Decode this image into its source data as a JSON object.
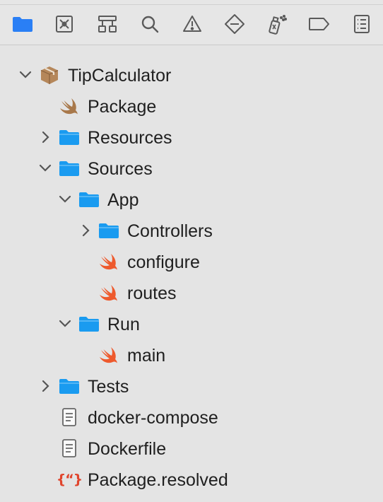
{
  "toolbar": {
    "items": [
      {
        "name": "project-navigator",
        "icon": "folder-icon",
        "active": true
      },
      {
        "name": "source-control-navigator",
        "icon": "source-control-icon"
      },
      {
        "name": "symbol-navigator",
        "icon": "hierarchy-icon"
      },
      {
        "name": "find-navigator",
        "icon": "search-icon"
      },
      {
        "name": "issue-navigator",
        "icon": "warning-icon"
      },
      {
        "name": "test-navigator",
        "icon": "test-diamond-icon"
      },
      {
        "name": "debug-navigator",
        "icon": "spray-icon"
      },
      {
        "name": "breakpoint-navigator",
        "icon": "breakpoint-icon"
      },
      {
        "name": "report-navigator",
        "icon": "report-icon"
      }
    ]
  },
  "tree": [
    {
      "label": "TipCalculator",
      "icon": "package-box-icon",
      "expanded": true
    },
    {
      "label": "Package",
      "icon": "swift-brown-icon"
    },
    {
      "label": "Resources",
      "icon": "folder-icon",
      "expanded": false
    },
    {
      "label": "Sources",
      "icon": "folder-icon",
      "expanded": true
    },
    {
      "label": "App",
      "icon": "folder-icon",
      "expanded": true
    },
    {
      "label": "Controllers",
      "icon": "folder-icon",
      "expanded": false
    },
    {
      "label": "configure",
      "icon": "swift-icon"
    },
    {
      "label": "routes",
      "icon": "swift-icon"
    },
    {
      "label": "Run",
      "icon": "folder-icon",
      "expanded": true
    },
    {
      "label": "main",
      "icon": "swift-icon"
    },
    {
      "label": "Tests",
      "icon": "folder-icon",
      "expanded": false
    },
    {
      "label": "docker-compose",
      "icon": "document-icon"
    },
    {
      "label": "Dockerfile",
      "icon": "document-icon"
    },
    {
      "label": "Package.resolved",
      "icon": "json-icon",
      "icon_text": "{“}"
    }
  ],
  "colors": {
    "accent": "#2a7ff5",
    "folder": "#1a9bf0",
    "swift": "#ee5a2d",
    "swift_brown": "#a8784a",
    "json": "#e0452d"
  }
}
